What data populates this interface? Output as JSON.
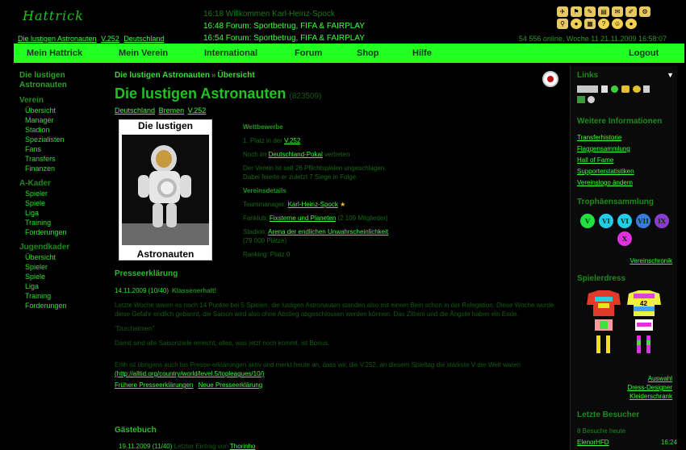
{
  "header": {
    "logo_text": "Hattrick",
    "team_name": "Die lustigen Astronauten",
    "league": "V.252",
    "country": "Deutschland",
    "news": [
      "16:18 Willkommen Karl-Heinz-Spock",
      "16:48 Forum: Sportbetrug, FIFA & FAIRPLAY",
      "16:54 Forum: Sportbetrug, FIFA & FAIRPLAY"
    ],
    "online_status": "54 556 online, Woche 11  21.11.2009 16:58:07"
  },
  "nav": {
    "items": [
      "Mein Hattrick",
      "Mein Verein",
      "International",
      "Forum",
      "Shop",
      "Hilfe",
      "Logout"
    ]
  },
  "sidebar": {
    "team_title": "Die lustigen Astronauten",
    "sections": [
      {
        "title": "Verein",
        "items": [
          "Übersicht",
          "Manager",
          "Stadion",
          "Spezialisten",
          "Fans",
          "Transfers",
          "Finanzen"
        ]
      },
      {
        "title": "A-Kader",
        "items": [
          "Spieler",
          "Spiele",
          "Liga",
          "Training",
          "Forderungen"
        ]
      },
      {
        "title": "Jugendkader",
        "items": [
          "Übersicht",
          "Spieler",
          "Spiele",
          "Liga",
          "Training",
          "Forderungen"
        ]
      }
    ]
  },
  "main": {
    "breadcrumb": [
      "Die lustigen Astronauten",
      "Übersicht"
    ],
    "breadcrumb_sep": "»",
    "title": "Die lustigen Astronauten",
    "team_id": "(823509)",
    "location": [
      "Deutschland",
      "Bremen",
      "V.252"
    ],
    "logo_top": "Die lustigen",
    "logo_bottom": "Astronauten",
    "competitions_heading": "Wettbewerbe",
    "competition_1_prefix": "1. Platz in der",
    "competition_1_link": "V.252",
    "competition_2_prefix": "Noch im",
    "competition_2_link": "Deutschland-Pokal",
    "competition_2_suffix": "vertreten",
    "streak_1": "Der Verein ist seit 26 Pflichtspielen ungeschlagen.",
    "streak_2": "Dabei feierte er zuletzt 7 Siege in Folge.",
    "details_heading": "Vereinsdetails",
    "manager_label": "Teammanager:",
    "manager_name": "Karl-Heinz-Spock",
    "fanclub_label": "Fanklub:",
    "fanclub_name": "Fixsterne und Planeten",
    "fanclub_members": "(2 109 Mitglieder)",
    "stadium_label": "Stadion:",
    "stadium_name": "Arena der endlichen Unwahrscheinlichkeit",
    "stadium_capacity": "(79 000 Plätze)",
    "ranking": "Ranking: Platz 0"
  },
  "press": {
    "heading": "Presseerklärung",
    "date": "14.11.2009 (10/40)",
    "headline": "Klassenerhalt!",
    "para1": "Letzte Woche waren es noch 14 Punkte bei 5 Spielen, die lustigen Astronauten standen also mit einem Bein schon in der Relegation. Diese Woche wurde diese Gefahr endlich gebannt, die Saison wird also ohne Abstieg abgeschlossen werden können. Das Zittern und die Ängste haben ein Ende.",
    "para2": "\"Durchatmen\"",
    "para3": "Damit sind alle Saisonziele erreicht, alles, was jetzt noch kommt, ist Bonus.",
    "para4": "Erlih ist übrigens auch bis Presse-erklärungen aktiv und merkt heute an, dass wir, die V.252, an diesem Spieltag die stärkste V der Welt waren",
    "para4_link": "(http://alltid.org/country/world/level.5/topleagues/10/)",
    "link_earlier": "Frühere Presseerklärungen",
    "link_new": "Neue Presseerklärung"
  },
  "guestbook": {
    "heading": "Gästebuch",
    "date": "19.11.2009 (11/40)",
    "entry_prefix": "Letzter Eintrag von",
    "entry_author": "Thorinho"
  },
  "right": {
    "links_heading": "Links",
    "info_heading": "Weitere Informationen",
    "info_links": [
      "Transferhistorie",
      "Flaggensammlung",
      "Hall of Fame",
      "Supporterstatistiken",
      "Vereinslogo ändern"
    ],
    "trophies_heading": "Trophäensammlung",
    "trophies": [
      "V",
      "VI",
      "VI",
      "VII",
      "IX",
      "X"
    ],
    "trophy_colors": [
      "#22e040",
      "#22ccee",
      "#22ccee",
      "#3a7ae0",
      "#8a3ad0",
      "#e030e0"
    ],
    "chronik_link": "Vereinschronik",
    "dress_heading": "Spielerdress",
    "dress_number": "42",
    "dress_links": [
      "Auswahl",
      "Dress-Designer",
      "Kleiderschrank"
    ],
    "visitors_heading": "Letzte Besucher",
    "visitors_today": "8 Besuche heute",
    "visitor_name": "ElenorHFD",
    "visitor_time": "16:24"
  }
}
